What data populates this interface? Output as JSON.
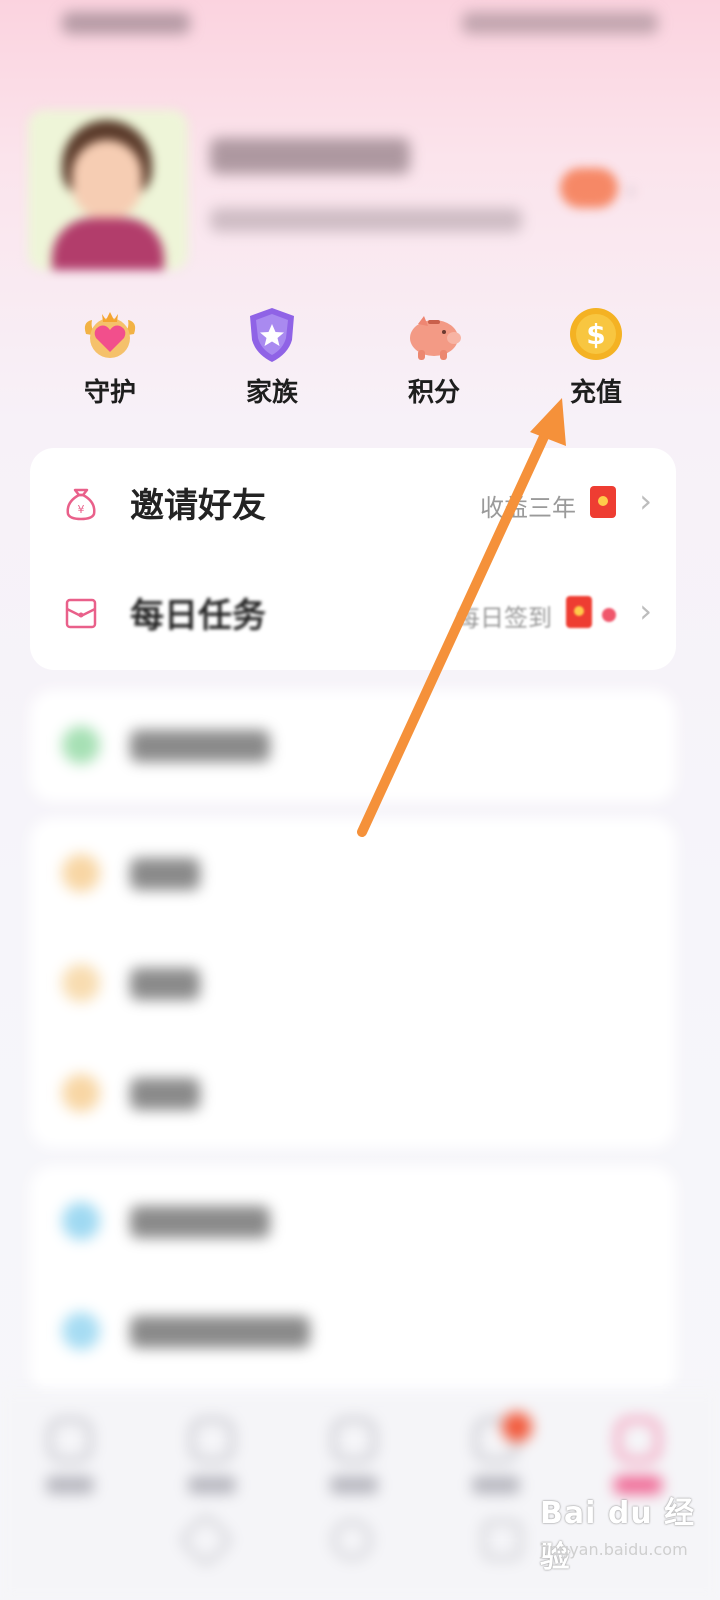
{
  "quick_actions": [
    {
      "label": "守护",
      "icon": "guard-heart-crown-icon"
    },
    {
      "label": "家族",
      "icon": "family-shield-star-icon"
    },
    {
      "label": "积分",
      "icon": "points-piggy-bank-icon"
    },
    {
      "label": "充值",
      "icon": "recharge-coin-icon"
    }
  ],
  "menu_primary": [
    {
      "title": "邀请好友",
      "subtitle": "收益三年",
      "icon": "money-bag-icon",
      "badge": "red-envelope-icon"
    },
    {
      "title": "每日任务",
      "subtitle": "每日签到",
      "icon": "task-envelope-icon",
      "badge": "red-envelope-icon",
      "dot": true
    }
  ],
  "colors": {
    "accent_pink": "#e9608a",
    "annotation_arrow": "#f5913a",
    "red_envelope": "#ee3d32"
  },
  "watermark": {
    "brand": "Bai du 经验",
    "url": "jingyan.baidu.com"
  }
}
